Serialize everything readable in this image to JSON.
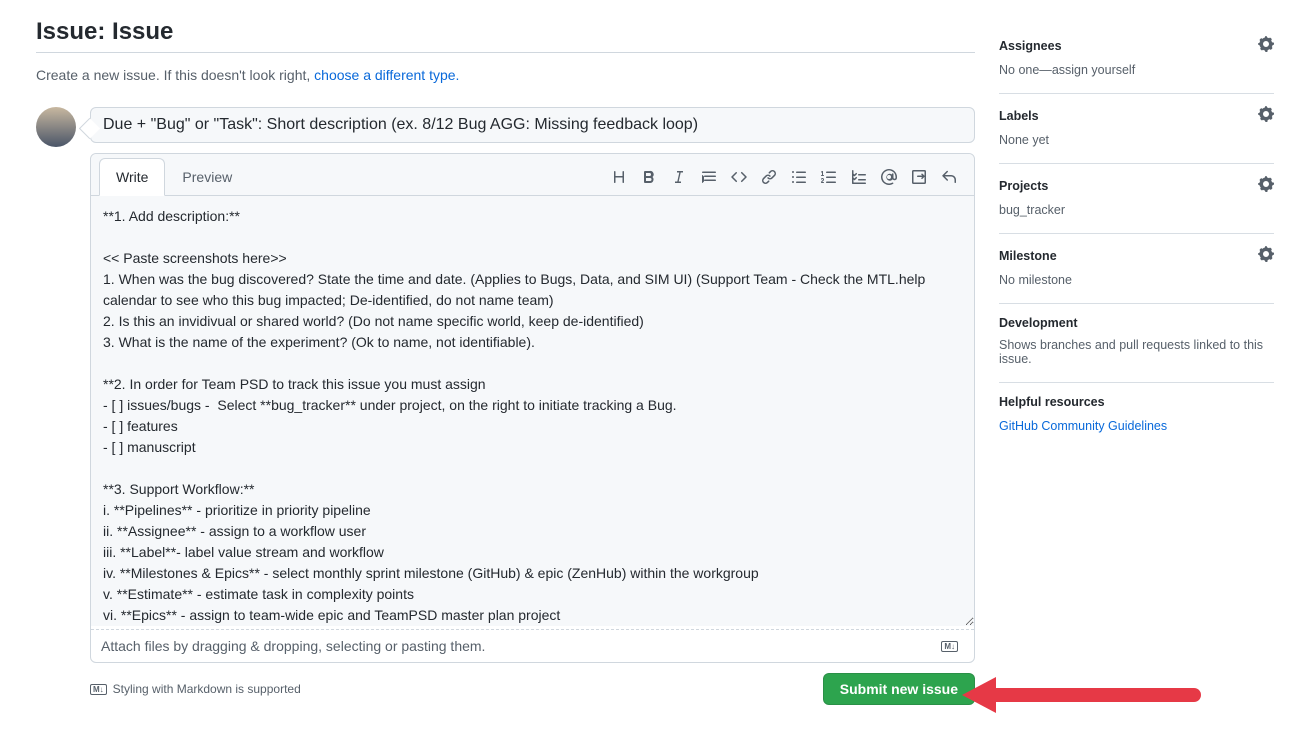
{
  "header": {
    "title": "Issue: Issue"
  },
  "subtitle": {
    "prefix": "Create a new issue. If this doesn't look right, ",
    "link": "choose a different type."
  },
  "title_input": {
    "value": "Due + \"Bug\" or \"Task\": Short description (ex. 8/12 Bug AGG: Missing feedback loop)"
  },
  "tabs": {
    "write": "Write",
    "preview": "Preview"
  },
  "body": "**1. Add description:**\n\n<< Paste screenshots here>>\n1. When was the bug discovered? State the time and date. (Applies to Bugs, Data, and SIM UI) (Support Team - Check the MTL.help calendar to see who this bug impacted; De-identified, do not name team)\n2. Is this an invidivual or shared world? (Do not name specific world, keep de-identified)\n3. What is the name of the experiment? (Ok to name, not identifiable).\n\n**2. In order for Team PSD to track this issue you must assign\n- [ ] issues/bugs -  Select **bug_tracker** under project, on the right to initiate tracking a Bug.\n- [ ] features\n- [ ] manuscript\n\n**3. Support Workflow:**\ni. **Pipelines** - prioritize in priority pipeline\nii. **Assignee** - assign to a workflow user\niii. **Label**- label value stream and workflow\niv. **Milestones & Epics** - select monthly sprint milestone (GitHub) & epic (ZenHub) within the workgroup\nv. **Estimate** - estimate task in complexity points\nvi. **Epics** - assign to team-wide epic and TeamPSD master plan project",
  "attach": "Attach files by dragging & dropping, selecting or pasting them.",
  "md_note": "Styling with Markdown is supported",
  "submit": "Submit new issue",
  "sidebar": {
    "assignees": {
      "label": "Assignees",
      "value_prefix": "No one—",
      "link": "assign yourself"
    },
    "labels": {
      "label": "Labels",
      "value": "None yet"
    },
    "projects": {
      "label": "Projects",
      "value": "bug_tracker"
    },
    "milestone": {
      "label": "Milestone",
      "value": "No milestone"
    },
    "development": {
      "label": "Development",
      "value": "Shows branches and pull requests linked to this issue."
    },
    "help": {
      "label": "Helpful resources",
      "link": "GitHub Community Guidelines"
    }
  },
  "md_badge": "M↓"
}
